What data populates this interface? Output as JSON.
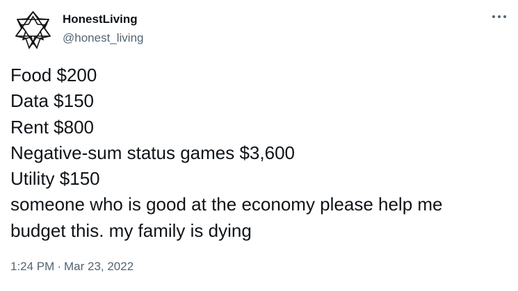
{
  "author": {
    "display_name": "HonestLiving",
    "handle": "@honest_living",
    "avatar_icon": "eight-pointed-star-icon"
  },
  "more_icon": "more-horizontal-icon",
  "tweet": {
    "lines": [
      "Food $200",
      "Data $150",
      "Rent $800",
      "Negative-sum status games $3,600",
      "Utility $150",
      "someone who is good at the economy please help me",
      "budget this. my family is dying"
    ],
    "time": "1:24 PM",
    "separator": "·",
    "date": "Mar 23, 2022"
  },
  "colors": {
    "text_primary": "#0f1419",
    "text_secondary": "#536471",
    "background": "#ffffff"
  }
}
